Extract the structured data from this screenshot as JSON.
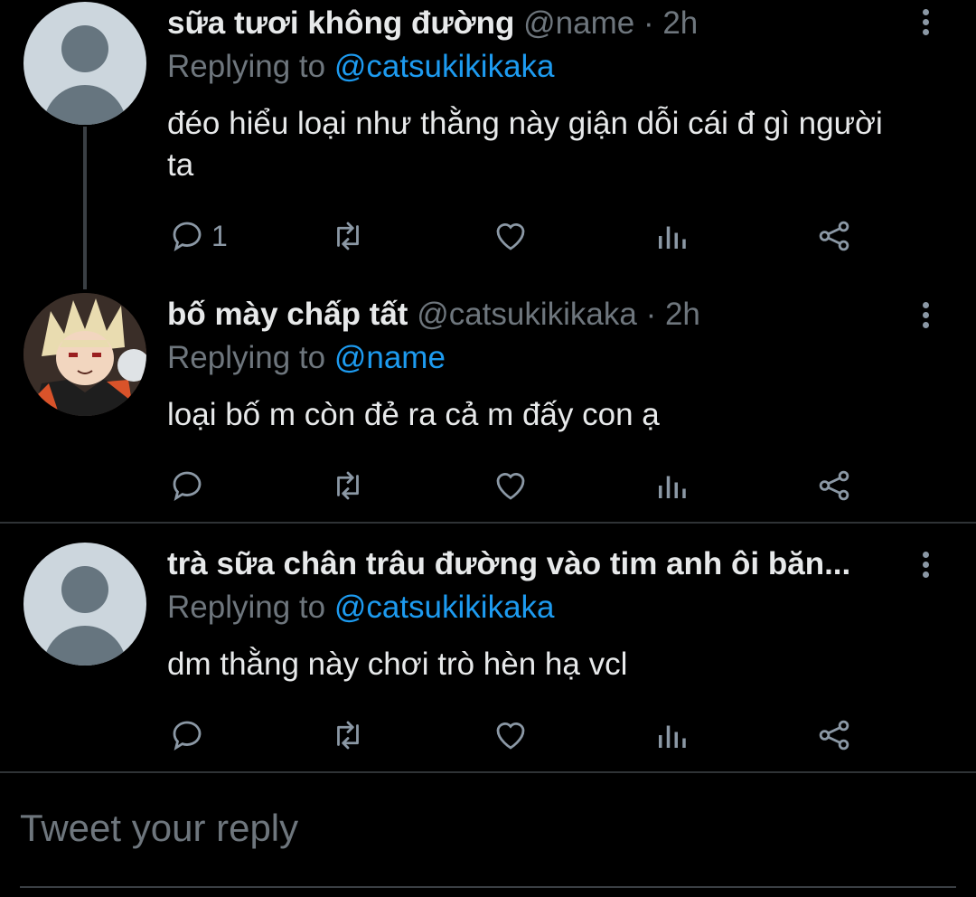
{
  "tweets": [
    {
      "display_name": "sữa tươi không đường",
      "handle_time": "@name · 2h",
      "replying_prefix": "Replying to ",
      "replying_to": "@catsukikikaka",
      "text": "đéo hiểu loại như thằng này giận dỗi cái đ gì người ta",
      "reply_count": "1",
      "avatar": "default-avatar"
    },
    {
      "display_name": "bố mày chấp tất",
      "handle_time": "@catsukikikaka · 2h",
      "replying_prefix": "Replying to ",
      "replying_to": "@name",
      "text": "loại bố m còn đẻ ra cả m đấy con ạ",
      "reply_count": "",
      "avatar": "anime-avatar"
    },
    {
      "display_name": "trà sữa chân trâu đường vào tim anh ôi băn...",
      "handle_time": "",
      "replying_prefix": "Replying to ",
      "replying_to": "@catsukikikaka",
      "text": "dm thằng này chơi trò hèn hạ vcl",
      "reply_count": "",
      "avatar": "default-avatar"
    }
  ],
  "composer": {
    "placeholder": "Tweet your reply"
  },
  "colors": {
    "background": "#000000",
    "mention": "#1d9bf0",
    "muted": "#6e767d"
  }
}
